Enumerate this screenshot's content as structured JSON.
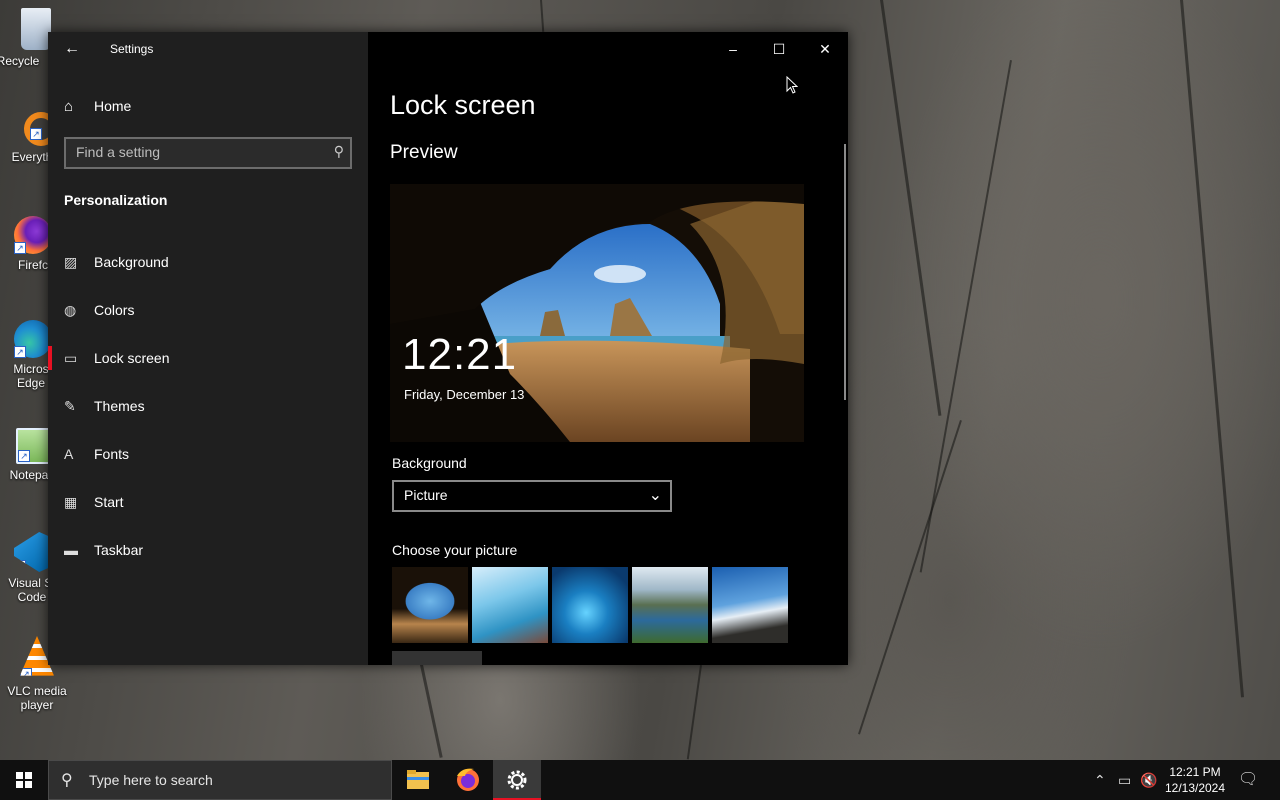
{
  "desktop": {
    "icons": [
      {
        "label": "Recycle",
        "icon": "recycle-bin-icon"
      },
      {
        "label": "Everyth",
        "icon": "everything-icon"
      },
      {
        "label": "Firefc",
        "icon": "firefox-icon"
      },
      {
        "label": "Micros Edge",
        "icon": "edge-icon"
      },
      {
        "label": "Notepac",
        "icon": "notepad-icon"
      },
      {
        "label": "Visual St Code",
        "icon": "vscode-icon"
      },
      {
        "label": "VLC media player",
        "icon": "vlc-icon"
      }
    ]
  },
  "window": {
    "app_title": "Settings",
    "back_icon": "back-arrow-icon",
    "controls": {
      "minimize": "–",
      "maximize": "☐",
      "close": "✕"
    }
  },
  "sidebar": {
    "home_label": "Home",
    "search_placeholder": "Find a setting",
    "section_title": "Personalization",
    "items": [
      {
        "label": "Background",
        "icon": "picture-icon",
        "active": false
      },
      {
        "label": "Colors",
        "icon": "palette-icon",
        "active": false
      },
      {
        "label": "Lock screen",
        "icon": "lock-screen-icon",
        "active": true
      },
      {
        "label": "Themes",
        "icon": "themes-icon",
        "active": false
      },
      {
        "label": "Fonts",
        "icon": "fonts-icon",
        "active": false
      },
      {
        "label": "Start",
        "icon": "start-icon",
        "active": false
      },
      {
        "label": "Taskbar",
        "icon": "taskbar-icon",
        "active": false
      }
    ]
  },
  "main": {
    "title": "Lock screen",
    "preview_heading": "Preview",
    "preview_time": "12:21",
    "preview_date": "Friday, December 13",
    "background_label": "Background",
    "background_value": "Picture",
    "choose_picture_label": "Choose your picture",
    "thumbnails": [
      "cave-beach",
      "sky-window",
      "underwater",
      "mountain-lake",
      "horizon"
    ]
  },
  "taskbar": {
    "search_placeholder": "Type here to search",
    "apps": [
      "file-explorer-icon",
      "firefox-icon",
      "settings-icon"
    ],
    "active_app": "settings-icon",
    "time": "12:21 PM",
    "date": "12/13/2024"
  },
  "colors": {
    "accent": "#e81123",
    "sidebar_bg": "#1f1f1f",
    "content_bg": "#000000"
  }
}
